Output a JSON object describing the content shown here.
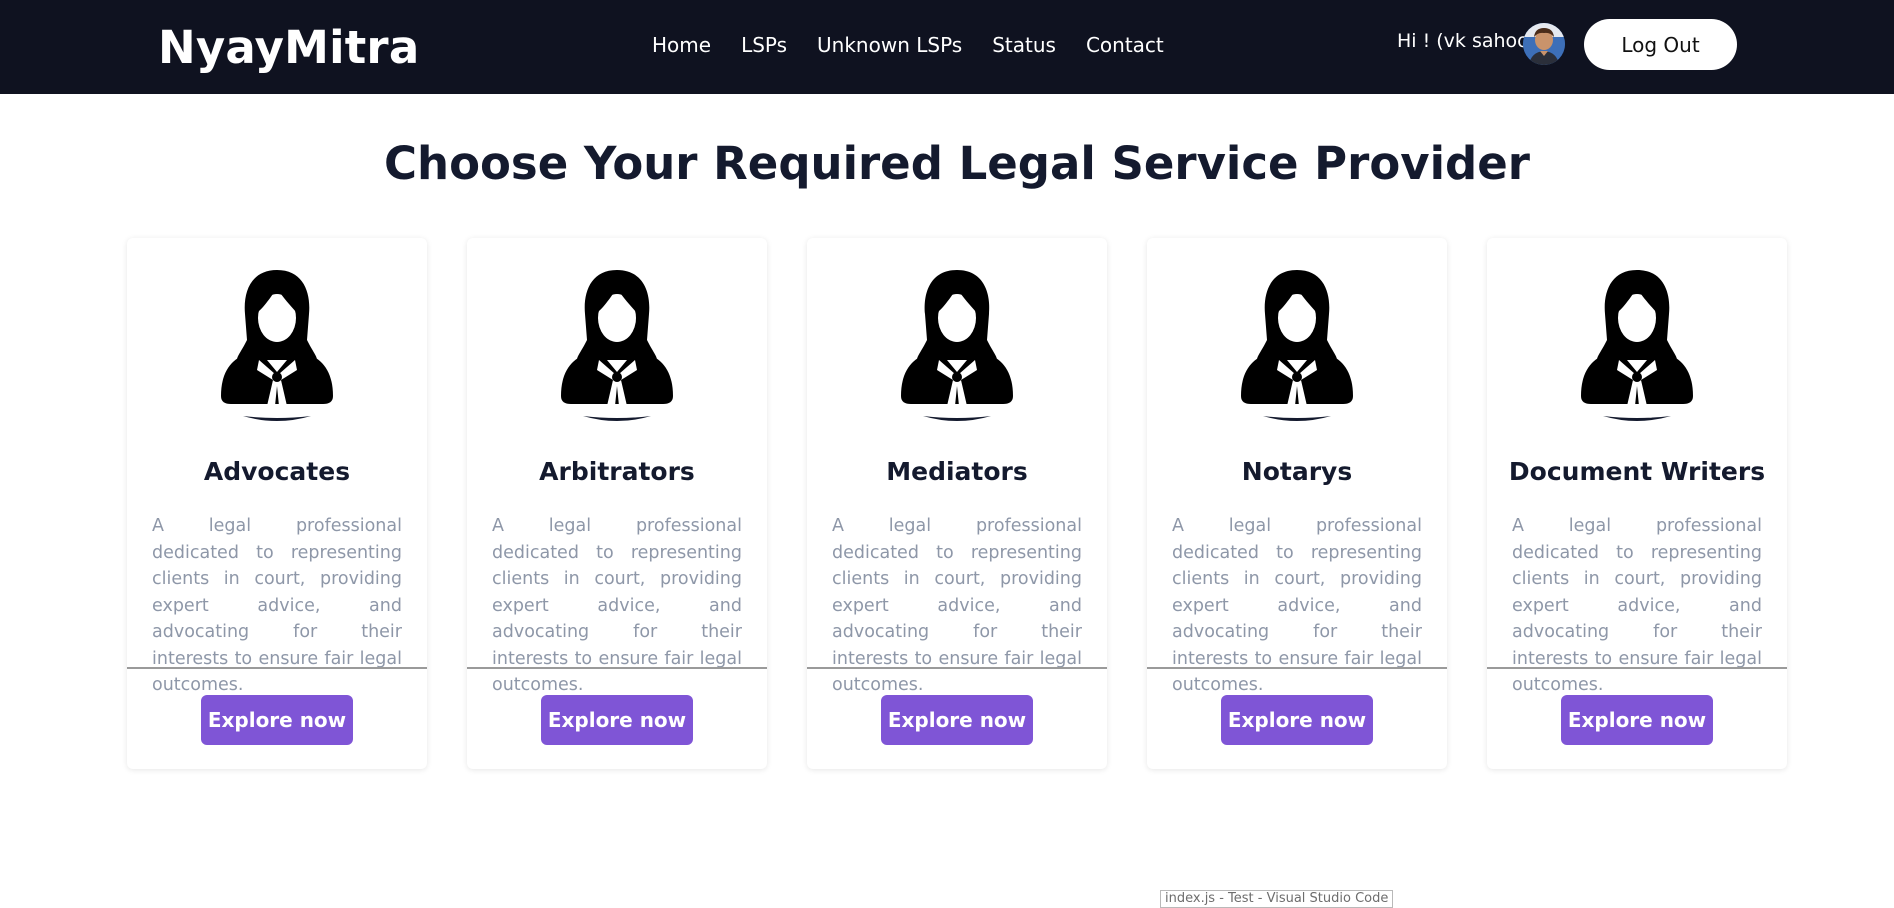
{
  "navbar": {
    "brand": "NyayMitra",
    "links": [
      {
        "label": "Home"
      },
      {
        "label": "LSPs"
      },
      {
        "label": "Unknown LSPs"
      },
      {
        "label": "Status"
      },
      {
        "label": "Contact"
      }
    ],
    "greeting": "Hi ! (vk sahoo)",
    "logout_label": "Log Out",
    "background_color": "#0f1220"
  },
  "main": {
    "title": "Choose Your Required Legal Service Provider",
    "cards": [
      {
        "title": "Advocates",
        "description": "A legal professional dedicated to representing clients in court, providing expert advice, and advocating for their interests to ensure fair legal outcomes.",
        "button_label": "Explore now",
        "icon": "female-lawyer-icon"
      },
      {
        "title": "Arbitrators",
        "description": "A legal professional dedicated to representing clients in court, providing expert advice, and advocating for their interests to ensure fair legal outcomes.",
        "button_label": "Explore now",
        "icon": "female-lawyer-icon"
      },
      {
        "title": "Mediators",
        "description": "A legal professional dedicated to representing clients in court, providing expert advice, and advocating for their interests to ensure fair legal outcomes.",
        "button_label": "Explore now",
        "icon": "female-lawyer-icon"
      },
      {
        "title": "Notarys",
        "description": "A legal professional dedicated to representing clients in court, providing expert advice, and advocating for their interests to ensure fair legal outcomes.",
        "button_label": "Explore now",
        "icon": "female-lawyer-icon"
      },
      {
        "title": "Document Writers",
        "description": "A legal professional dedicated to representing clients in court, providing expert advice, and advocating for their interests to ensure fair legal outcomes.",
        "button_label": "Explore now",
        "icon": "female-lawyer-icon"
      }
    ],
    "accent_color": "#7f55d6"
  },
  "tooltip": {
    "text": "index.js - Test - Visual Studio Code"
  }
}
